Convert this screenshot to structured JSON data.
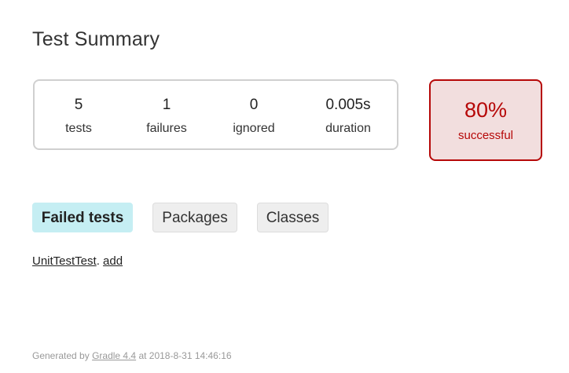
{
  "page": {
    "title": "Test Summary"
  },
  "summary": {
    "tests": {
      "value": "5",
      "label": "tests"
    },
    "failures": {
      "value": "1",
      "label": "failures"
    },
    "ignored": {
      "value": "0",
      "label": "ignored"
    },
    "duration": {
      "value": "0.005s",
      "label": "duration"
    }
  },
  "success_rate": {
    "value": "80%",
    "label": "successful",
    "color": "#b60808",
    "background": "#f2dede"
  },
  "tabs": [
    {
      "label": "Failed tests",
      "selected": true
    },
    {
      "label": "Packages",
      "selected": false
    },
    {
      "label": "Classes",
      "selected": false
    }
  ],
  "failed_tests": {
    "class_link": "UnitTestTest",
    "separator": ". ",
    "method_link": "add"
  },
  "footer": {
    "prefix": "Generated by ",
    "link": "Gradle 4.4",
    "suffix": " at 2018-8-31 14:46:16"
  },
  "colors": {
    "selected_tab": "#c5eef3",
    "tab": "#eeeeee",
    "footer_text": "#999999"
  }
}
